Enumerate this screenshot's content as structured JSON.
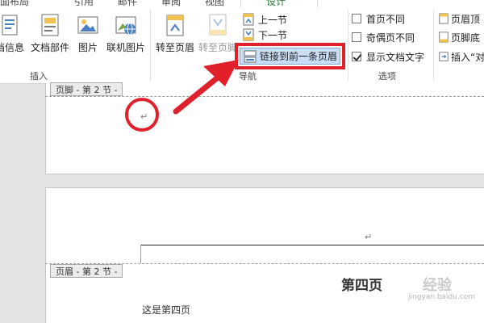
{
  "ribbon": {
    "tabs": [
      {
        "label": "页面布局"
      },
      {
        "label": "引用"
      },
      {
        "label": "邮件"
      },
      {
        "label": "审阅"
      },
      {
        "label": "视图"
      },
      {
        "label": "设计"
      }
    ],
    "insert_group": {
      "label": "插入",
      "buttons": [
        {
          "label": "档信息"
        },
        {
          "label": "文档部件"
        },
        {
          "label": "图片"
        },
        {
          "label": "联机图片"
        }
      ]
    },
    "nav_group": {
      "label": "导航",
      "goto_header": "转至页眉",
      "goto_footer": "转至页脚",
      "prev_section": "上一节",
      "next_section": "下一节",
      "link_previous": "链接到前一条页眉"
    },
    "options_group": {
      "label": "选项",
      "different_first": "首页不同",
      "different_odd_even": "奇偶页不同",
      "show_doc_text": "显示文档文字",
      "show_doc_text_checked": true
    },
    "position_group": {
      "header_top": "页眉顶",
      "footer_bottom": "页脚底",
      "insert_align": "插入“对"
    }
  },
  "document": {
    "footer_tag": "页脚 - 第 2 节 -",
    "header_tag": "页眉 - 第 2 节 -",
    "para_mark": "↵",
    "heading": "第四页",
    "body": "这是第四页",
    "watermark": "经验",
    "watermark_url": "jingyan.baidu.com"
  },
  "annotation": {
    "highlight_color": "#e0202a"
  }
}
